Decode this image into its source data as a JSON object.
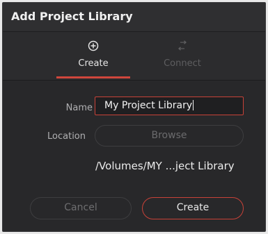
{
  "dialog": {
    "title": "Add Project Library"
  },
  "tabs": [
    {
      "label": "Create",
      "icon": "plus-circle-icon",
      "active": true
    },
    {
      "label": "Connect",
      "icon": "swap-arrows-icon",
      "active": false
    }
  ],
  "form": {
    "name_label": "Name",
    "name_value": "My Project Library",
    "location_label": "Location",
    "browse_label": "Browse",
    "path": "/Volumes/MY ...ject Library"
  },
  "actions": {
    "cancel_label": "Cancel",
    "create_label": "Create"
  },
  "colors": {
    "accent": "#c94238",
    "background": "#28282a",
    "titlebar": "#2f2f31"
  }
}
